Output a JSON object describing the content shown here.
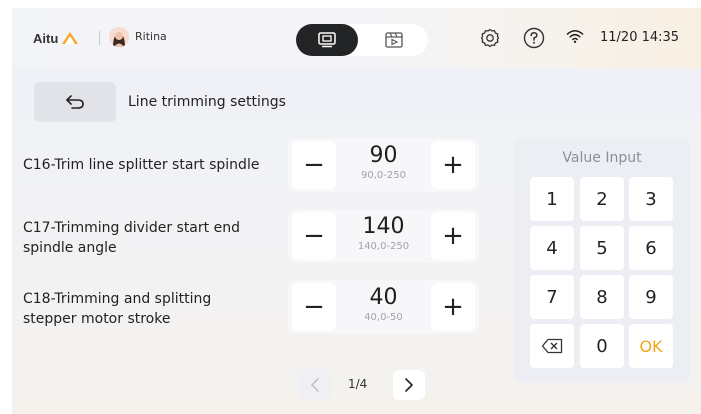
{
  "header": {
    "logo_text": "Aitu",
    "user_name": "Ritina",
    "datetime": "11/20 14:35",
    "icons": [
      "settings-icon",
      "help-icon",
      "wifi-icon"
    ]
  },
  "nav": {
    "title": "Line trimming settings"
  },
  "params": [
    {
      "label": "C16-Trim line splitter start spindle",
      "value": "90",
      "range": "90,0-250"
    },
    {
      "label": "C17-Trimming divider start end spindle angle",
      "value": "140",
      "range": "140,0-250"
    },
    {
      "label": "C18-Trimming and splitting stepper motor stroke",
      "value": "40",
      "range": "40,0-50"
    }
  ],
  "stepper": {
    "minus": "−",
    "plus": "+"
  },
  "pager": {
    "text": "1/4"
  },
  "keypad": {
    "title": "Value Input",
    "keys": [
      "1",
      "2",
      "3",
      "4",
      "5",
      "6",
      "7",
      "8",
      "9",
      "0",
      "OK"
    ]
  },
  "colors": {
    "accent": "#f3a41c",
    "dark": "#222426"
  }
}
